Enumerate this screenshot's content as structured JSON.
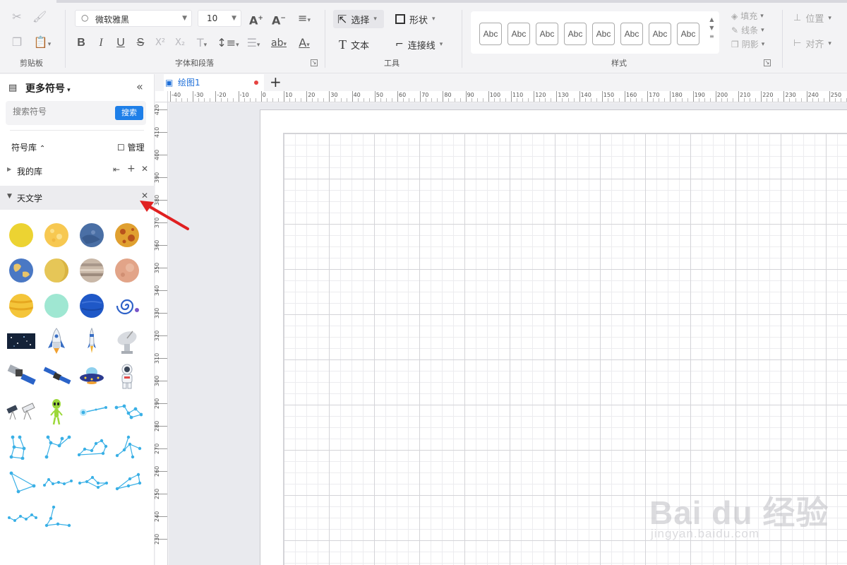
{
  "ribbon": {
    "groups": {
      "clipboard": "剪贴板",
      "font_paragraph": "字体和段落",
      "tools": "工具",
      "styles": "样式"
    },
    "font_family": "微软雅黑",
    "font_size": "10",
    "tools": {
      "select": "选择",
      "shape": "形状",
      "text": "文本",
      "connector": "连接线"
    },
    "style_samples": [
      "Abc",
      "Abc",
      "Abc",
      "Abc",
      "Abc",
      "Abc",
      "Abc",
      "Abc"
    ],
    "right": {
      "fill": "填充",
      "line": "线条",
      "shadow": "阴影",
      "position": "位置",
      "align": "对齐"
    }
  },
  "sidebar": {
    "title": "更多符号",
    "search_placeholder": "搜索符号",
    "search_button": "搜索",
    "library_header": "符号库",
    "manage": "管理",
    "libraries": [
      {
        "label": "我的库",
        "expanded": false
      },
      {
        "label": "天文学",
        "expanded": true
      }
    ]
  },
  "document": {
    "tab_title": "绘图1"
  },
  "rulers": {
    "horizontal": [
      "-40",
      "-30",
      "-20",
      "-10",
      "0",
      "10",
      "20",
      "30",
      "40",
      "50",
      "60",
      "70",
      "80",
      "90",
      "100",
      "110",
      "120",
      "130",
      "140",
      "150",
      "160",
      "170",
      "180",
      "190",
      "200",
      "210",
      "220",
      "230",
      "240",
      "250"
    ],
    "vertical": [
      "420",
      "410",
      "400",
      "390",
      "380",
      "370",
      "360",
      "350",
      "340",
      "330",
      "320",
      "310",
      "300",
      "290",
      "280",
      "270",
      "260",
      "250",
      "240",
      "230"
    ]
  },
  "watermark": {
    "brand": "Bai du 经验",
    "url": "jingyan.baidu.com"
  },
  "colors": {
    "accent": "#1e7fe8",
    "tab_text": "#1e6fd9",
    "modified_dot": "#e64340",
    "annotation_arrow": "#e02020"
  }
}
